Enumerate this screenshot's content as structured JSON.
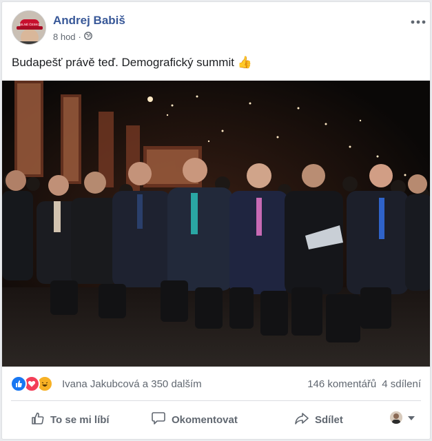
{
  "post": {
    "author": "Andrej Babiš",
    "time": "8 hod",
    "separator": "·",
    "privacy_icon": "globe-icon",
    "more_icon": "more-dots-icon",
    "text": "Budapešť právě teď. Demografický summit",
    "text_emoji": "👍",
    "avatar_cap_text": "SILNÉ ČESKO"
  },
  "reactions": {
    "icons": [
      "like-icon",
      "love-icon",
      "haha-icon"
    ],
    "summary": "Ivana Jakubcová a 350 dalším",
    "comments": "146 komentářů",
    "shares": "4 sdílení"
  },
  "actions": {
    "like": "To se mi líbí",
    "comment": "Okomentovat",
    "share": "Sdílet"
  },
  "colors": {
    "link_blue": "#385898",
    "text_gray": "#606770",
    "like_blue": "#1877f2",
    "love_red": "#f33e58",
    "haha_yellow": "#f7b125"
  }
}
